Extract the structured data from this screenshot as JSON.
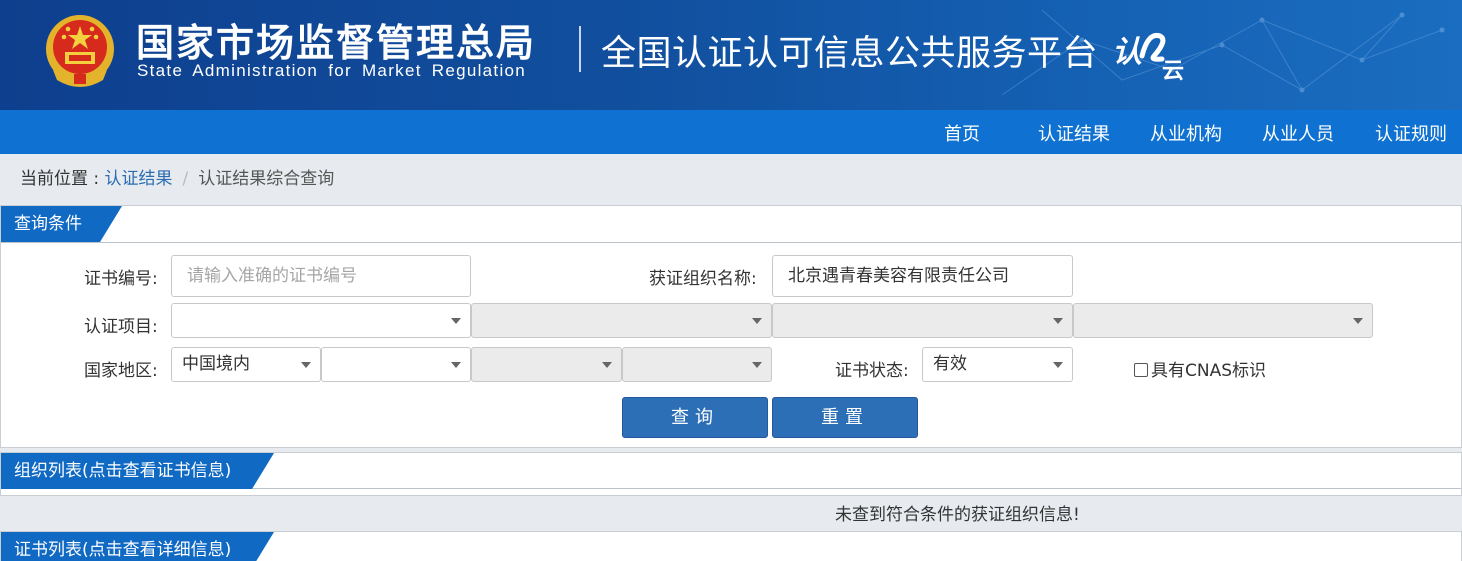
{
  "header": {
    "org_name_cn": "国家市场监督管理总局",
    "org_name_en": "State Administration  for  Market Regulation",
    "platform_title": "全国认证认可信息公共服务平台",
    "logo_text": "认云"
  },
  "nav": {
    "items": [
      "首页",
      "认证结果",
      "从业机构",
      "从业人员",
      "认证规则"
    ]
  },
  "breadcrumb": {
    "prefix": "当前位置 : ",
    "link": "认证结果",
    "separator": "/",
    "current": "认证结果综合查询"
  },
  "query_panel": {
    "title": "查询条件",
    "cert_no_label": "证书编号:",
    "cert_no_placeholder": "请输入准确的证书编号",
    "org_name_label": "获证组织名称:",
    "org_name_value": "北京遇青春美容有限责任公司",
    "project_label": "认证项目:",
    "project_selects": [
      "",
      "",
      "",
      ""
    ],
    "region_label": "国家地区:",
    "region_selects": [
      "中国境内",
      "",
      "",
      ""
    ],
    "status_label": "证书状态:",
    "status_value": "有效",
    "cnas_label": "具有CNAS标识",
    "search_button": "查询",
    "reset_button": "重置"
  },
  "org_panel": {
    "title": "组织列表(点击查看证书信息)",
    "empty_message": "未查到符合条件的获证组织信息!"
  },
  "cert_panel": {
    "title": "证书列表(点击查看详细信息)"
  },
  "colors": {
    "header_blue": "#11509f",
    "nav_blue": "#0f72d2",
    "tab_blue": "#1069c3",
    "button_blue": "#2d6fb6"
  }
}
